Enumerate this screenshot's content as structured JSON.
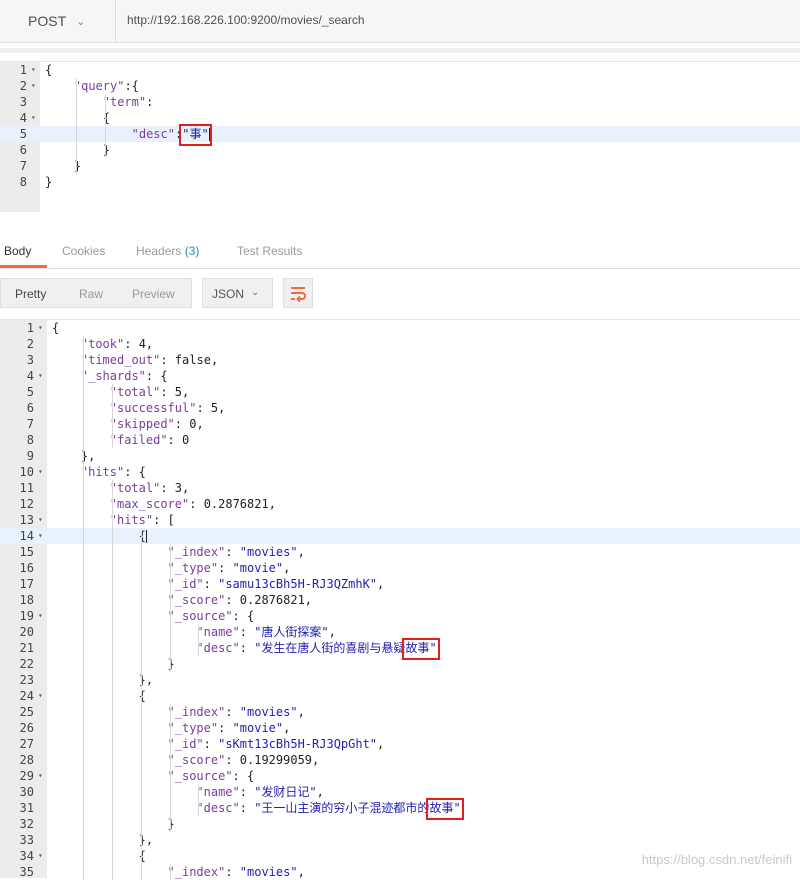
{
  "request": {
    "method": "POST",
    "url": "http://192.168.226.100:9200/movies/_search"
  },
  "tabs": [
    {
      "label": "Body",
      "active": true
    },
    {
      "label": "Cookies"
    },
    {
      "label": "Headers",
      "count": "(3)"
    },
    {
      "label": "Test Results"
    }
  ],
  "view_modes": [
    "Pretty",
    "Raw",
    "Preview"
  ],
  "active_view": "Pretty",
  "format_label": "JSON",
  "icons": {
    "method_dropdown": "chevron-down-icon",
    "format_dropdown": "chevron-down-icon",
    "wrap": "wrap-lines-icon",
    "fold": "fold-arrow-icon"
  },
  "colors": {
    "accent": "#f26b3a",
    "key": "#7a3e9d",
    "string": "#1f1fb0",
    "highlight_box": "#e0201a"
  },
  "request_body": [
    {
      "n": "1",
      "fold": true,
      "indent": 0,
      "tokens": [
        {
          "t": "{",
          "c": "p"
        }
      ]
    },
    {
      "n": "2",
      "fold": true,
      "indent": 1,
      "tokens": [
        {
          "t": "\"query\"",
          "c": "k"
        },
        {
          "t": ":{",
          "c": "p"
        }
      ]
    },
    {
      "n": "3",
      "indent": 2,
      "tokens": [
        {
          "t": "\"term\"",
          "c": "k"
        },
        {
          "t": ":",
          "c": "p"
        }
      ]
    },
    {
      "n": "4",
      "fold": true,
      "indent": 2,
      "tokens": [
        {
          "t": "{",
          "c": "p"
        }
      ]
    },
    {
      "n": "5",
      "hl": true,
      "indent": 3,
      "tokens": [
        {
          "t": "\"desc\"",
          "c": "k"
        },
        {
          "t": ":",
          "c": "p"
        },
        {
          "t": "\"事\"",
          "c": "s"
        }
      ],
      "cursor": true
    },
    {
      "n": "6",
      "indent": 2,
      "tokens": [
        {
          "t": "}",
          "c": "p"
        }
      ]
    },
    {
      "n": "7",
      "indent": 1,
      "tokens": [
        {
          "t": "}",
          "c": "p"
        }
      ]
    },
    {
      "n": "8",
      "indent": 0,
      "tokens": [
        {
          "t": "}",
          "c": "p"
        }
      ]
    }
  ],
  "response_body": [
    {
      "n": "1",
      "fold": true,
      "indent": 0,
      "tokens": [
        {
          "t": "{",
          "c": "p"
        }
      ]
    },
    {
      "n": "2",
      "indent": 1,
      "tokens": [
        {
          "t": "\"took\"",
          "c": "k"
        },
        {
          "t": ": ",
          "c": "p"
        },
        {
          "t": "4",
          "c": "n"
        },
        {
          "t": ",",
          "c": "p"
        }
      ]
    },
    {
      "n": "3",
      "indent": 1,
      "tokens": [
        {
          "t": "\"timed_out\"",
          "c": "k"
        },
        {
          "t": ": ",
          "c": "p"
        },
        {
          "t": "false",
          "c": "n"
        },
        {
          "t": ",",
          "c": "p"
        }
      ]
    },
    {
      "n": "4",
      "fold": true,
      "indent": 1,
      "tokens": [
        {
          "t": "\"_shards\"",
          "c": "k"
        },
        {
          "t": ": {",
          "c": "p"
        }
      ]
    },
    {
      "n": "5",
      "indent": 2,
      "tokens": [
        {
          "t": "\"total\"",
          "c": "k"
        },
        {
          "t": ": ",
          "c": "p"
        },
        {
          "t": "5",
          "c": "n"
        },
        {
          "t": ",",
          "c": "p"
        }
      ]
    },
    {
      "n": "6",
      "indent": 2,
      "tokens": [
        {
          "t": "\"successful\"",
          "c": "k"
        },
        {
          "t": ": ",
          "c": "p"
        },
        {
          "t": "5",
          "c": "n"
        },
        {
          "t": ",",
          "c": "p"
        }
      ]
    },
    {
      "n": "7",
      "indent": 2,
      "tokens": [
        {
          "t": "\"skipped\"",
          "c": "k"
        },
        {
          "t": ": ",
          "c": "p"
        },
        {
          "t": "0",
          "c": "n"
        },
        {
          "t": ",",
          "c": "p"
        }
      ]
    },
    {
      "n": "8",
      "indent": 2,
      "tokens": [
        {
          "t": "\"failed\"",
          "c": "k"
        },
        {
          "t": ": ",
          "c": "p"
        },
        {
          "t": "0",
          "c": "n"
        }
      ]
    },
    {
      "n": "9",
      "indent": 1,
      "tokens": [
        {
          "t": "},",
          "c": "p"
        }
      ]
    },
    {
      "n": "10",
      "fold": true,
      "indent": 1,
      "tokens": [
        {
          "t": "\"hits\"",
          "c": "k"
        },
        {
          "t": ": {",
          "c": "p"
        }
      ]
    },
    {
      "n": "11",
      "indent": 2,
      "tokens": [
        {
          "t": "\"total\"",
          "c": "k"
        },
        {
          "t": ": ",
          "c": "p"
        },
        {
          "t": "3",
          "c": "n"
        },
        {
          "t": ",",
          "c": "p"
        }
      ]
    },
    {
      "n": "12",
      "indent": 2,
      "tokens": [
        {
          "t": "\"max_score\"",
          "c": "k"
        },
        {
          "t": ": ",
          "c": "p"
        },
        {
          "t": "0.2876821",
          "c": "n"
        },
        {
          "t": ",",
          "c": "p"
        }
      ]
    },
    {
      "n": "13",
      "fold": true,
      "indent": 2,
      "tokens": [
        {
          "t": "\"hits\"",
          "c": "k"
        },
        {
          "t": ": [",
          "c": "p"
        }
      ]
    },
    {
      "n": "14",
      "fold": true,
      "hl": true,
      "indent": 3,
      "tokens": [
        {
          "t": "{",
          "c": "p"
        }
      ],
      "cursor": true
    },
    {
      "n": "15",
      "indent": 4,
      "tokens": [
        {
          "t": "\"_index\"",
          "c": "k"
        },
        {
          "t": ": ",
          "c": "p"
        },
        {
          "t": "\"movies\"",
          "c": "s"
        },
        {
          "t": ",",
          "c": "p"
        }
      ]
    },
    {
      "n": "16",
      "indent": 4,
      "tokens": [
        {
          "t": "\"_type\"",
          "c": "k"
        },
        {
          "t": ": ",
          "c": "p"
        },
        {
          "t": "\"movie\"",
          "c": "s"
        },
        {
          "t": ",",
          "c": "p"
        }
      ]
    },
    {
      "n": "17",
      "indent": 4,
      "tokens": [
        {
          "t": "\"_id\"",
          "c": "k"
        },
        {
          "t": ": ",
          "c": "p"
        },
        {
          "t": "\"samu13cBh5H-RJ3QZmhK\"",
          "c": "s"
        },
        {
          "t": ",",
          "c": "p"
        }
      ]
    },
    {
      "n": "18",
      "indent": 4,
      "tokens": [
        {
          "t": "\"_score\"",
          "c": "k"
        },
        {
          "t": ": ",
          "c": "p"
        },
        {
          "t": "0.2876821",
          "c": "n"
        },
        {
          "t": ",",
          "c": "p"
        }
      ]
    },
    {
      "n": "19",
      "fold": true,
      "indent": 4,
      "tokens": [
        {
          "t": "\"_source\"",
          "c": "k"
        },
        {
          "t": ": {",
          "c": "p"
        }
      ]
    },
    {
      "n": "20",
      "indent": 5,
      "tokens": [
        {
          "t": "\"name\"",
          "c": "k"
        },
        {
          "t": ": ",
          "c": "p"
        },
        {
          "t": "\"唐人街探案\"",
          "c": "s"
        },
        {
          "t": ",",
          "c": "p"
        }
      ]
    },
    {
      "n": "21",
      "indent": 5,
      "tokens": [
        {
          "t": "\"desc\"",
          "c": "k"
        },
        {
          "t": ": ",
          "c": "p"
        },
        {
          "t": "\"发生在唐人街的喜剧与悬疑",
          "c": "s"
        },
        {
          "t": "故事\"",
          "c": "s",
          "mark": true
        }
      ]
    },
    {
      "n": "22",
      "indent": 4,
      "tokens": [
        {
          "t": "}",
          "c": "p"
        }
      ]
    },
    {
      "n": "23",
      "indent": 3,
      "tokens": [
        {
          "t": "},",
          "c": "p"
        }
      ]
    },
    {
      "n": "24",
      "fold": true,
      "indent": 3,
      "tokens": [
        {
          "t": "{",
          "c": "p"
        }
      ]
    },
    {
      "n": "25",
      "indent": 4,
      "tokens": [
        {
          "t": "\"_index\"",
          "c": "k"
        },
        {
          "t": ": ",
          "c": "p"
        },
        {
          "t": "\"movies\"",
          "c": "s"
        },
        {
          "t": ",",
          "c": "p"
        }
      ]
    },
    {
      "n": "26",
      "indent": 4,
      "tokens": [
        {
          "t": "\"_type\"",
          "c": "k"
        },
        {
          "t": ": ",
          "c": "p"
        },
        {
          "t": "\"movie\"",
          "c": "s"
        },
        {
          "t": ",",
          "c": "p"
        }
      ]
    },
    {
      "n": "27",
      "indent": 4,
      "tokens": [
        {
          "t": "\"_id\"",
          "c": "k"
        },
        {
          "t": ": ",
          "c": "p"
        },
        {
          "t": "\"sKmt13cBh5H-RJ3QpGht\"",
          "c": "s"
        },
        {
          "t": ",",
          "c": "p"
        }
      ]
    },
    {
      "n": "28",
      "indent": 4,
      "tokens": [
        {
          "t": "\"_score\"",
          "c": "k"
        },
        {
          "t": ": ",
          "c": "p"
        },
        {
          "t": "0.19299059",
          "c": "n"
        },
        {
          "t": ",",
          "c": "p"
        }
      ]
    },
    {
      "n": "29",
      "fold": true,
      "indent": 4,
      "tokens": [
        {
          "t": "\"_source\"",
          "c": "k"
        },
        {
          "t": ": {",
          "c": "p"
        }
      ]
    },
    {
      "n": "30",
      "indent": 5,
      "tokens": [
        {
          "t": "\"name\"",
          "c": "k"
        },
        {
          "t": ": ",
          "c": "p"
        },
        {
          "t": "\"发财日记\"",
          "c": "s"
        },
        {
          "t": ",",
          "c": "p"
        }
      ]
    },
    {
      "n": "31",
      "indent": 5,
      "tokens": [
        {
          "t": "\"desc\"",
          "c": "k"
        },
        {
          "t": ": ",
          "c": "p"
        },
        {
          "t": "\"王一山主演的穷小子混迹都市的",
          "c": "s"
        },
        {
          "t": "故事\"",
          "c": "s",
          "mark": true
        }
      ]
    },
    {
      "n": "32",
      "indent": 4,
      "tokens": [
        {
          "t": "}",
          "c": "p"
        }
      ]
    },
    {
      "n": "33",
      "indent": 3,
      "tokens": [
        {
          "t": "},",
          "c": "p"
        }
      ]
    },
    {
      "n": "34",
      "fold": true,
      "indent": 3,
      "tokens": [
        {
          "t": "{",
          "c": "p"
        }
      ]
    },
    {
      "n": "35",
      "indent": 4,
      "tokens": [
        {
          "t": "\"_index\"",
          "c": "k"
        },
        {
          "t": ": ",
          "c": "p"
        },
        {
          "t": "\"movies\"",
          "c": "s"
        },
        {
          "t": ",",
          "c": "p"
        }
      ]
    }
  ],
  "watermark": "https://blog.csdn.net/feinifi"
}
